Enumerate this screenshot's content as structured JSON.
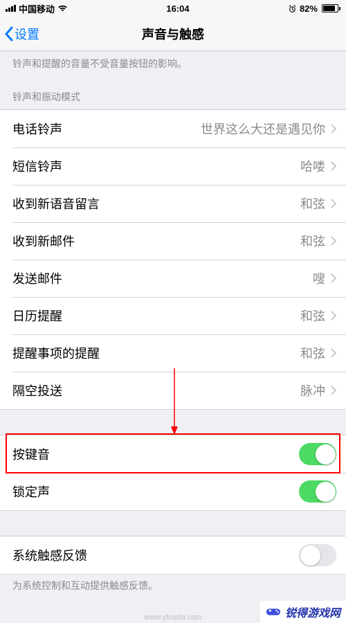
{
  "status": {
    "carrier": "中国移动",
    "time": "16:04",
    "battery_text": "82%"
  },
  "nav": {
    "back_label": "设置",
    "title": "声音与触感"
  },
  "notes": {
    "volume_note": "铃声和提醒的音量不受音量按钮的影响。"
  },
  "sections": {
    "ring_patterns_header": "铃声和振动模式",
    "haptics_footer": "为系统控制和互动提供触感反馈。"
  },
  "cells": {
    "ringtone": {
      "label": "电话铃声",
      "value": "世界这么大还是遇见你"
    },
    "texttone": {
      "label": "短信铃声",
      "value": "哈喽"
    },
    "voicemail": {
      "label": "收到新语音留言",
      "value": "和弦"
    },
    "newmail": {
      "label": "收到新邮件",
      "value": "和弦"
    },
    "sentmail": {
      "label": "发送邮件",
      "value": "嗖"
    },
    "calendar": {
      "label": "日历提醒",
      "value": "和弦"
    },
    "reminder": {
      "label": "提醒事项的提醒",
      "value": "和弦"
    },
    "airdrop": {
      "label": "隔空投送",
      "value": "脉冲"
    }
  },
  "toggles": {
    "keyboard_clicks": {
      "label": "按键音",
      "on": true
    },
    "lock_sound": {
      "label": "锁定声",
      "on": true
    },
    "system_haptics": {
      "label": "系统触感反馈",
      "on": false
    }
  },
  "watermark": {
    "brand": "锐得游戏网",
    "url": "www.ytruida.com"
  }
}
